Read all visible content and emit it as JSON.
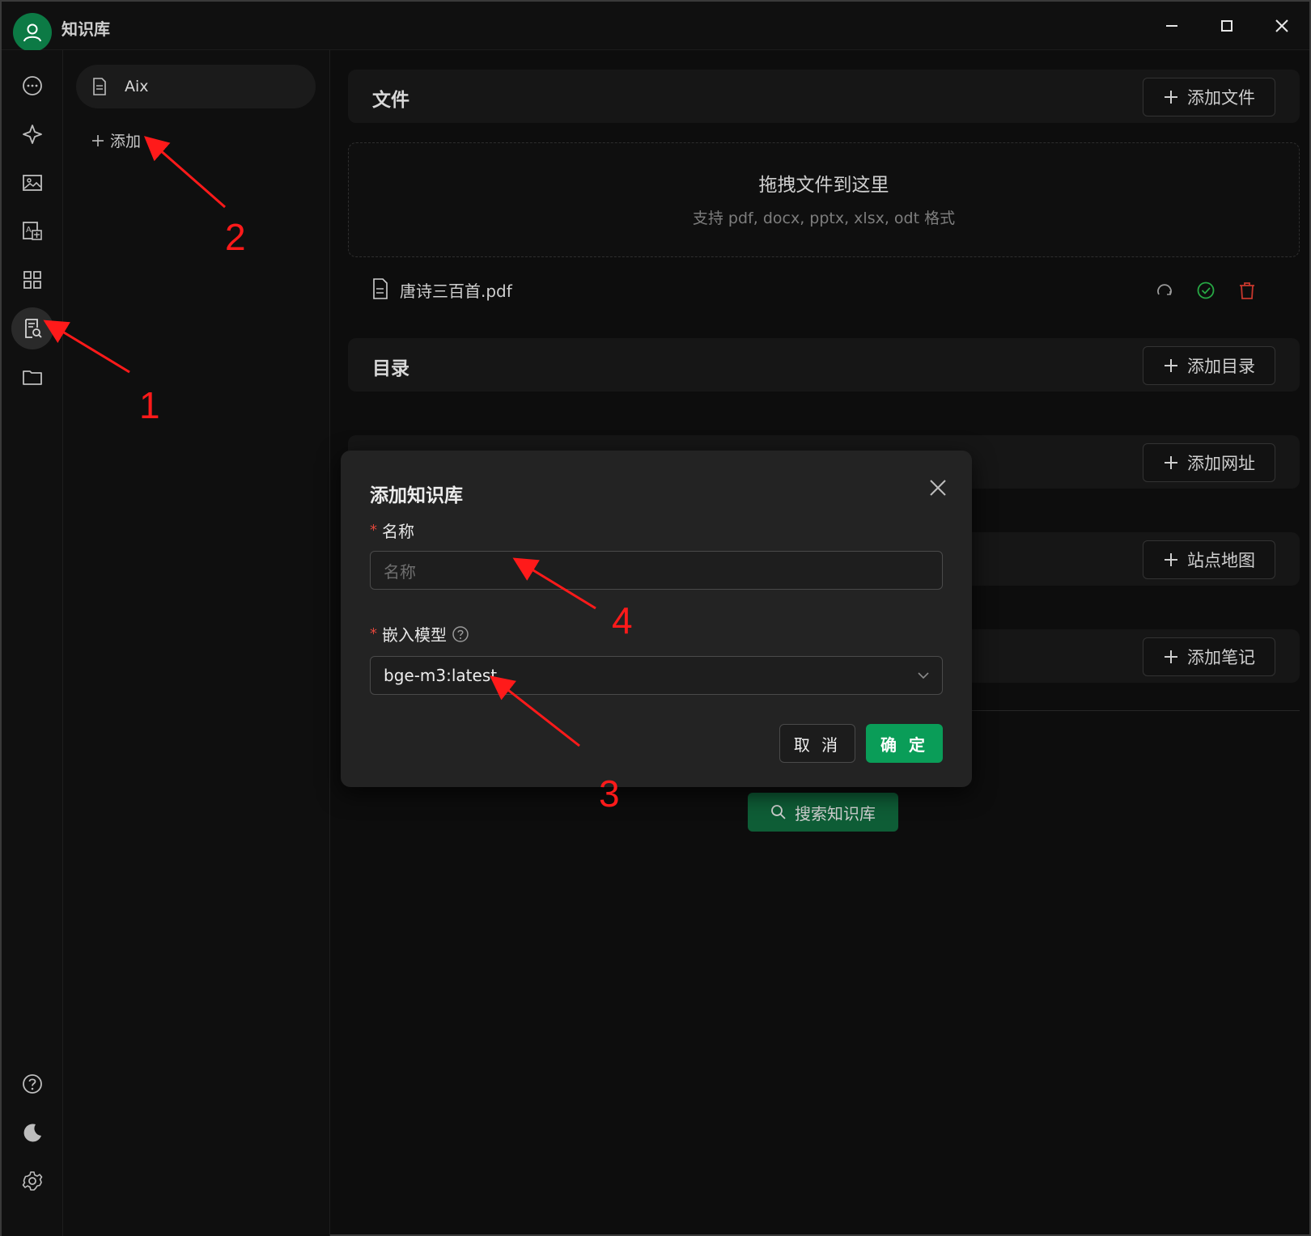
{
  "titlebar": {
    "title": "知识库"
  },
  "rail": {
    "items": [
      {
        "icon": "chat-icon"
      },
      {
        "icon": "sparkle-icon"
      },
      {
        "icon": "image-icon"
      },
      {
        "icon": "translate-icon"
      },
      {
        "icon": "apps-grid-icon"
      },
      {
        "icon": "knowledge-base-icon",
        "active": true
      },
      {
        "icon": "folder-icon"
      }
    ],
    "bottom": [
      {
        "icon": "help-icon"
      },
      {
        "icon": "moon-icon"
      },
      {
        "icon": "gear-icon"
      }
    ]
  },
  "kb_panel": {
    "items": [
      {
        "label": "Aix",
        "icon": "document-icon"
      }
    ],
    "add_label": "添加"
  },
  "main": {
    "files": {
      "title": "文件",
      "add_label": "添加文件",
      "dropzone_title": "拖拽文件到这里",
      "dropzone_sub": "支持 pdf, docx, pptx, xlsx, odt 格式",
      "items": [
        {
          "name": "唐诗三百首.pdf",
          "status": "done"
        }
      ]
    },
    "directory": {
      "title": "目录",
      "add_label": "添加目录"
    },
    "url": {
      "add_label": "添加网址"
    },
    "sitemap": {
      "add_label": "站点地图"
    },
    "notes": {
      "add_label": "添加笔记"
    },
    "search_label": "搜索知识库"
  },
  "modal": {
    "title": "添加知识库",
    "name_label": "名称",
    "name_placeholder": "名称",
    "model_label": "嵌入模型",
    "model_value": "bge-m3:latest",
    "cancel_label": "取 消",
    "ok_label": "确 定"
  },
  "annotations": [
    "1",
    "2",
    "3",
    "4"
  ],
  "colors": {
    "accent": "#0a9d58",
    "avatar": "#0c7a45",
    "danger": "#c8372d",
    "success": "#27a844",
    "annotation": "#ff1a1a"
  }
}
